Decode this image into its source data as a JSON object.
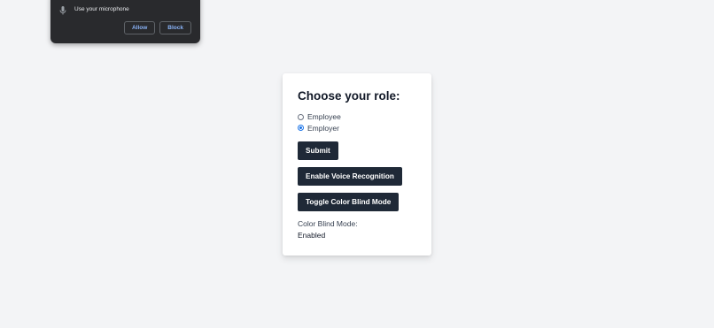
{
  "permission_popup": {
    "icon": "microphone-icon",
    "message": "Use your microphone",
    "allow_label": "Allow",
    "block_label": "Block"
  },
  "card": {
    "title": "Choose your role:",
    "roles": [
      {
        "label": "Employee",
        "selected": false
      },
      {
        "label": "Employer",
        "selected": true
      }
    ],
    "submit_label": "Submit",
    "voice_label": "Enable Voice Recognition",
    "colorblind_label": "Toggle Color Blind Mode",
    "status_label": "Color Blind Mode:",
    "status_value": "Enabled"
  },
  "colors": {
    "page_background": "#f3f4f6",
    "button_background": "#1f2937",
    "popup_background": "#292a2d",
    "popup_button_text": "#8ab4f8"
  }
}
